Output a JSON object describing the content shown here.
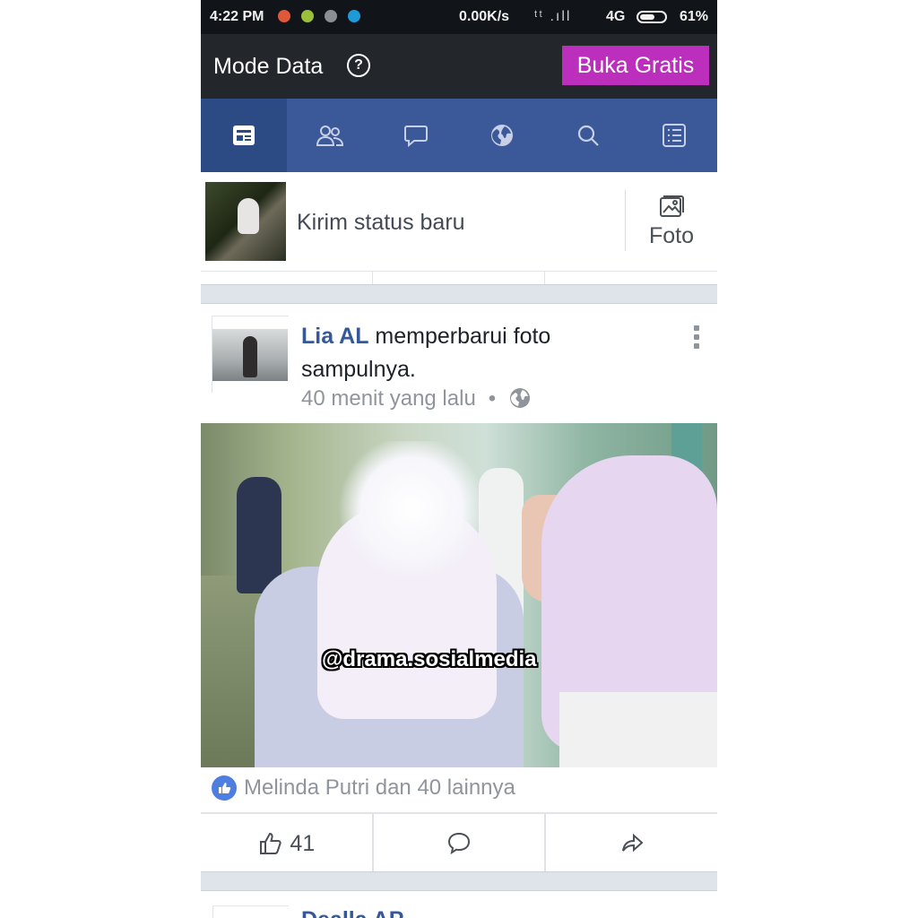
{
  "status_bar": {
    "time": "4:22 PM",
    "net_rate": "0.00K/s",
    "signal_text": "ᵗᵗ .ıll",
    "network": "4G",
    "battery_level": 0.61,
    "battery_pct": "61%",
    "notification_icons": [
      "orange-app-icon",
      "green-app-icon",
      "gray-app-icon",
      "blue-app-icon"
    ]
  },
  "data_bar": {
    "title": "Mode Data",
    "help_symbol": "?",
    "free_button": "Buka Gratis"
  },
  "nav": {
    "tabs": [
      "news-feed-icon",
      "friends-icon",
      "messages-icon",
      "notifications-globe-icon",
      "search-icon",
      "menu-list-icon"
    ],
    "active": 0,
    "colors": {
      "bar": "#3b5998",
      "active": "#2c4a83"
    }
  },
  "composer": {
    "prompt": "Kirim status baru",
    "photo_label": "Foto"
  },
  "post": {
    "author": "Lia AL",
    "action": " memperbarui foto sampulnya.",
    "time": "40 menit yang lalu",
    "separator": "•",
    "privacy_icon": "globe-icon",
    "watermark": "@drama.sosialmedia",
    "likes_text": "Melinda Putri dan 40 lainnya",
    "like_count": "41"
  },
  "next_post": {
    "partial_text": "Dealla AP"
  }
}
